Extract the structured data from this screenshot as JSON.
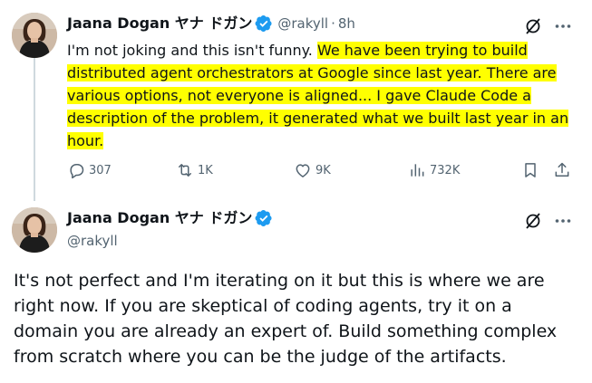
{
  "tweet1": {
    "author_name": "Jaana Dogan ヤナ ドガン",
    "handle": "@rakyll",
    "separator": "·",
    "time": "8h",
    "text_plain": "I'm not joking and this isn't funny. ",
    "text_highlighted": "We have been trying to build distributed agent orchestrators at Google since last year. There are various options, not everyone is aligned... I gave Claude Code a description of the problem, it generated what we built last year in an hour.",
    "highlight_color": "#ffff00",
    "stats": {
      "replies": "307",
      "retweets": "1K",
      "likes": "9K",
      "views": "732K"
    }
  },
  "tweet2": {
    "author_name": "Jaana Dogan ヤナ ドガン",
    "handle": "@rakyll",
    "text": "It's not perfect and I'm iterating on it but this is where we are right now. If you are skeptical of coding agents, try it on a domain you are already an expert of. Build something complex from scratch where you can be the judge of the artifacts."
  },
  "colors": {
    "verified": "#1d9bf0",
    "secondary_text": "#536471",
    "primary_text": "#0f1419",
    "thread_line": "#cfd9de"
  },
  "icons": {
    "verified": "verified-badge-icon",
    "grok": "grok-icon",
    "more": "more-icon",
    "reply": "reply-icon",
    "retweet": "retweet-icon",
    "like": "like-icon",
    "views": "views-icon",
    "bookmark": "bookmark-icon",
    "share": "share-icon"
  }
}
